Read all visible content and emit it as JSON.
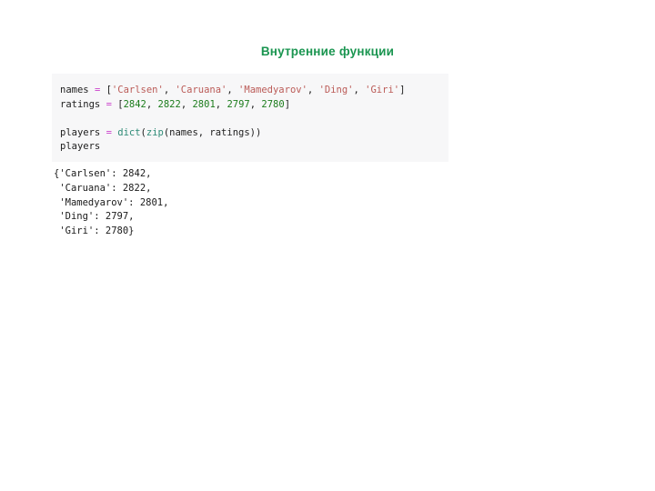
{
  "slide": {
    "title": "Внутренние функции",
    "title_color": "#1a9550",
    "background_color": "#ffffff"
  },
  "code_cell": {
    "background_color": "#f7f7f8",
    "language": "python",
    "lines": [
      {
        "id": "line-names",
        "tokens": [
          {
            "text": "names",
            "kind": "name"
          },
          {
            "text": " ",
            "kind": "punct"
          },
          {
            "text": "=",
            "kind": "op"
          },
          {
            "text": " ",
            "kind": "punct"
          },
          {
            "text": "[",
            "kind": "punct"
          },
          {
            "text": "'Carlsen'",
            "kind": "str"
          },
          {
            "text": ", ",
            "kind": "punct"
          },
          {
            "text": "'Caruana'",
            "kind": "str"
          },
          {
            "text": ", ",
            "kind": "punct"
          },
          {
            "text": "'Mamedyarov'",
            "kind": "str"
          },
          {
            "text": ", ",
            "kind": "punct"
          },
          {
            "text": "'Ding'",
            "kind": "str"
          },
          {
            "text": ", ",
            "kind": "punct"
          },
          {
            "text": "'Giri'",
            "kind": "str"
          },
          {
            "text": "]",
            "kind": "punct"
          }
        ]
      },
      {
        "id": "line-ratings",
        "tokens": [
          {
            "text": "ratings",
            "kind": "name"
          },
          {
            "text": " ",
            "kind": "punct"
          },
          {
            "text": "=",
            "kind": "op"
          },
          {
            "text": " ",
            "kind": "punct"
          },
          {
            "text": "[",
            "kind": "punct"
          },
          {
            "text": "2842",
            "kind": "num"
          },
          {
            "text": ", ",
            "kind": "punct"
          },
          {
            "text": "2822",
            "kind": "num"
          },
          {
            "text": ", ",
            "kind": "punct"
          },
          {
            "text": "2801",
            "kind": "num"
          },
          {
            "text": ", ",
            "kind": "punct"
          },
          {
            "text": "2797",
            "kind": "num"
          },
          {
            "text": ", ",
            "kind": "punct"
          },
          {
            "text": "2780",
            "kind": "num"
          },
          {
            "text": "]",
            "kind": "punct"
          }
        ]
      },
      {
        "id": "line-blank",
        "tokens": []
      },
      {
        "id": "line-players-assign",
        "tokens": [
          {
            "text": "players",
            "kind": "name"
          },
          {
            "text": " ",
            "kind": "punct"
          },
          {
            "text": "=",
            "kind": "op"
          },
          {
            "text": " ",
            "kind": "punct"
          },
          {
            "text": "dict",
            "kind": "built"
          },
          {
            "text": "(",
            "kind": "punct"
          },
          {
            "text": "zip",
            "kind": "built"
          },
          {
            "text": "(names, ratings))",
            "kind": "punct"
          }
        ]
      },
      {
        "id": "line-players-echo",
        "tokens": [
          {
            "text": "players",
            "kind": "name"
          }
        ]
      }
    ]
  },
  "output_cell": {
    "lines": [
      "{'Carlsen': 2842,",
      " 'Caruana': 2822,",
      " 'Mamedyarov': 2801,",
      " 'Ding': 2797,",
      " 'Giri': 2780}"
    ]
  }
}
